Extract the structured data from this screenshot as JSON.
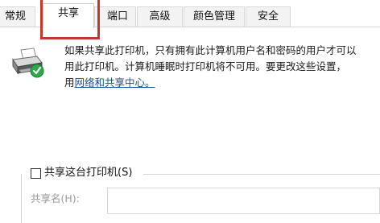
{
  "tabs": [
    {
      "label": "常规",
      "active": false
    },
    {
      "label": "共享",
      "active": true
    },
    {
      "label": "端口",
      "active": false
    },
    {
      "label": "高级",
      "active": false
    },
    {
      "label": "颜色管理",
      "active": false
    },
    {
      "label": "安全",
      "active": false
    }
  ],
  "info": {
    "line1": "如果共享此打印机，只有拥有此计算机用户名和密码的用户才可以",
    "line2": "用此打印机。计算机睡眠时打印机将不可用。要更改这些设置，",
    "line3_prefix": "用",
    "line3_link": "网络和共享中心。"
  },
  "share": {
    "checkbox_label": "共享这台打印机(S)",
    "checked": false,
    "sharename_label": "共享名(H):",
    "sharename_value": ""
  },
  "icons": {
    "printer": "printer-shared-icon",
    "checkmark": "green-check-icon"
  },
  "colors": {
    "highlight": "#c0392b",
    "link": "#1a4f9c",
    "check_green": "#2ea84a"
  }
}
